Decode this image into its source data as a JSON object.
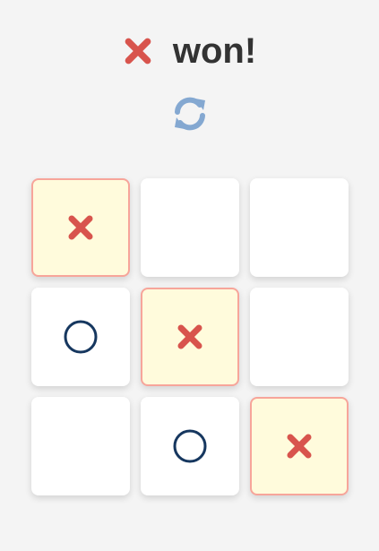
{
  "status": {
    "winner_icon": "x-icon",
    "text": "won!",
    "color": "#333333"
  },
  "reset": {
    "icon": "refresh-icon",
    "color": "#84a8d1"
  },
  "board": {
    "cells": [
      {
        "mark": "x",
        "highlight": true
      },
      {
        "mark": "",
        "highlight": false
      },
      {
        "mark": "",
        "highlight": false
      },
      {
        "mark": "o",
        "highlight": false
      },
      {
        "mark": "x",
        "highlight": true
      },
      {
        "mark": "",
        "highlight": false
      },
      {
        "mark": "",
        "highlight": false
      },
      {
        "mark": "o",
        "highlight": false
      },
      {
        "mark": "x",
        "highlight": true
      }
    ]
  },
  "colors": {
    "x": "#d8544d",
    "o": "#16375f",
    "win_bg": "#fffbdc",
    "win_border": "#f7a59a",
    "background": "#f4f4f4"
  }
}
